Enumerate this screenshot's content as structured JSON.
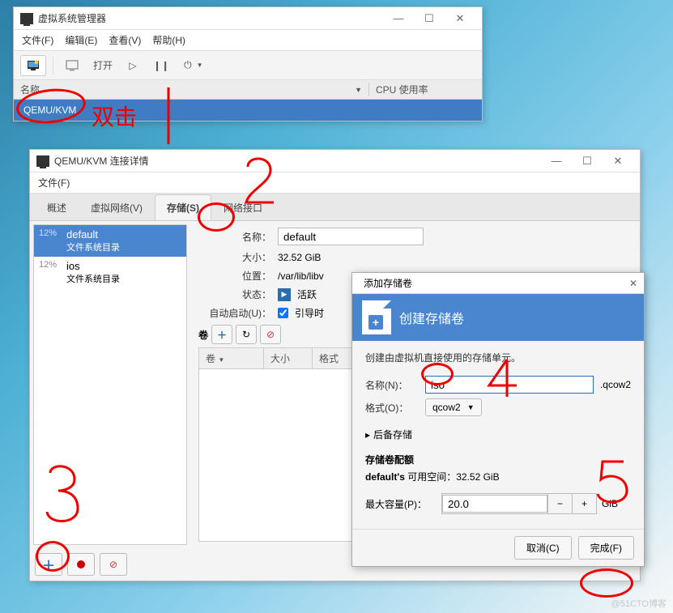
{
  "win1": {
    "title": "虚拟系统管理器",
    "menu": {
      "file": "文件(F)",
      "edit": "编辑(E)",
      "view": "查看(V)",
      "help": "帮助(H)"
    },
    "toolbar": {
      "open": "打开"
    },
    "listhdr": {
      "name": "名称",
      "cpu": "CPU 使用率"
    },
    "row": "QEMU/KVM"
  },
  "win2": {
    "title": "QEMU/KVM 连接详情",
    "menu_file": "文件(F)",
    "tabs": {
      "overview": "概述",
      "vnet": "虚拟网络(V)",
      "storage": "存储(S)",
      "netif": "网络接口"
    },
    "pools": [
      {
        "pct": "12%",
        "name": "default",
        "sub": "文件系统目录"
      },
      {
        "pct": "12%",
        "name": "ios",
        "sub": "文件系统目录"
      }
    ],
    "labels": {
      "name": "名称：",
      "size": "大小：",
      "location": "位置：",
      "state": "状态：",
      "autostart": "自动启动(U)：",
      "volumes": "卷",
      "vols_col_vol": "卷",
      "vols_col_size": "大小",
      "vols_col_fmt": "格式"
    },
    "values": {
      "name": "default",
      "size": "32.52 GiB",
      "location": "/var/lib/libv",
      "state": "活跃",
      "autostart": "引导时"
    }
  },
  "dlg": {
    "wintitle": "添加存储卷",
    "header": "创建存储卷",
    "desc": "创建由虚拟机直接使用的存储单元。",
    "labels": {
      "name": "名称(N)：",
      "format": "格式(O)：",
      "backing": "后备存储",
      "quota": "存储卷配额",
      "maxcap": "最大容量(P)："
    },
    "values": {
      "name": "iso",
      "ext": ".qcow2",
      "format": "qcow2",
      "quota_line_a": "default's",
      "quota_line_b": "可用空间：32.52 GiB",
      "maxcap": "20.0",
      "unit": "GiB"
    },
    "buttons": {
      "cancel": "取消(C)",
      "finish": "完成(F)"
    }
  },
  "annotations": {
    "dblclick": "双击",
    "n1": "1",
    "n2": "2",
    "n3": "3",
    "n4": "4",
    "n5": "5"
  },
  "watermark": "@51CTO博客"
}
